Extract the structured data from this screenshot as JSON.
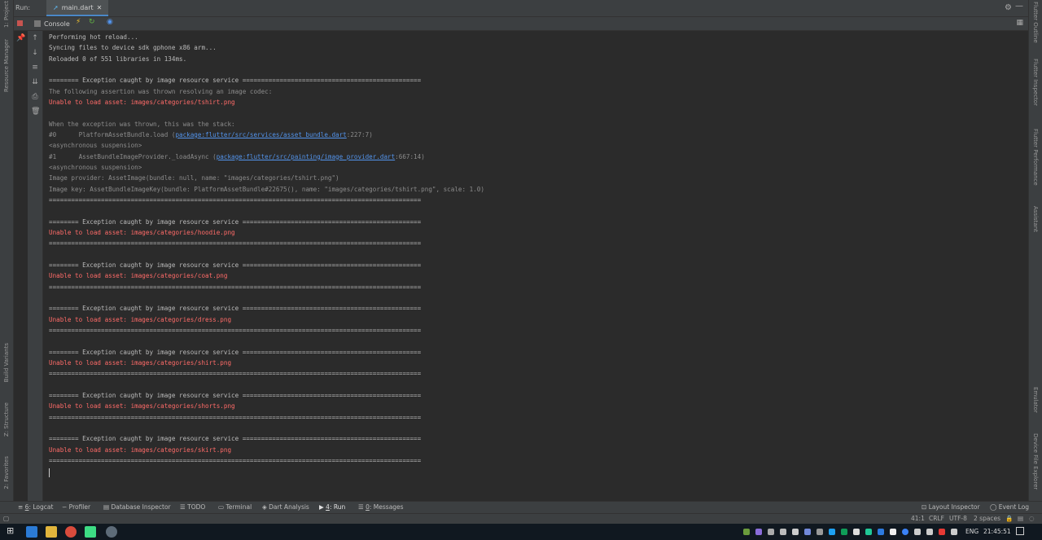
{
  "run_window": {
    "run_label": "Run:",
    "tab_name": "main.dart",
    "console_label": "Console"
  },
  "left_strip": {
    "project": "1: Project",
    "resource_manager": "Resource Manager",
    "build_variants": "Build Variants",
    "structure": "Z: Structure",
    "favorites": "2: Favorites"
  },
  "right_strip": {
    "flutter_outline": "Flutter Outline",
    "flutter_inspector": "Flutter Inspector",
    "flutter_performance": "Flutter Performance",
    "assistant": "Assistant",
    "emulator": "Emulator",
    "device_file_explorer": "Device File Explorer"
  },
  "console_lines": [
    {
      "text": "Performing hot reload...",
      "style": "normal"
    },
    {
      "text": "Syncing files to device sdk gphone x86 arm...",
      "style": "normal"
    },
    {
      "text": "Reloaded 0 of 551 libraries in 134ms.",
      "style": "normal"
    },
    {
      "text": "",
      "style": "normal"
    },
    {
      "text": "======== Exception caught by image resource service ================================================",
      "style": "normal"
    },
    {
      "text": "The following assertion was thrown resolving an image codec:",
      "style": "gray"
    },
    {
      "text": "Unable to load asset: images/categories/tshirt.png",
      "style": "err"
    },
    {
      "text": "",
      "style": "normal"
    },
    {
      "text": "When the exception was thrown, this was the stack:",
      "style": "gray"
    },
    {
      "text": "#0      PlatformAssetBundle.load (",
      "style": "gray",
      "link": "package:flutter/src/services/asset_bundle.dart",
      "after": ":227:7)"
    },
    {
      "text": "<asynchronous suspension>",
      "style": "gray"
    },
    {
      "text": "#1      AssetBundleImageProvider._loadAsync (",
      "style": "gray",
      "link": "package:flutter/src/painting/image_provider.dart",
      "after": ":667:14)"
    },
    {
      "text": "<asynchronous suspension>",
      "style": "gray"
    },
    {
      "text": "Image provider: AssetImage(bundle: null, name: \"images/categories/tshirt.png\")",
      "style": "gray"
    },
    {
      "text": "Image key: AssetBundleImageKey(bundle: PlatformAssetBundle#22675(), name: \"images/categories/tshirt.png\", scale: 1.0)",
      "style": "gray"
    },
    {
      "text": "====================================================================================================",
      "style": "normal"
    },
    {
      "text": "",
      "style": "normal"
    },
    {
      "text": "======== Exception caught by image resource service ================================================",
      "style": "normal"
    },
    {
      "text": "Unable to load asset: images/categories/hoodie.png",
      "style": "err"
    },
    {
      "text": "====================================================================================================",
      "style": "normal"
    },
    {
      "text": "",
      "style": "normal"
    },
    {
      "text": "======== Exception caught by image resource service ================================================",
      "style": "normal"
    },
    {
      "text": "Unable to load asset: images/categories/coat.png",
      "style": "err"
    },
    {
      "text": "====================================================================================================",
      "style": "normal"
    },
    {
      "text": "",
      "style": "normal"
    },
    {
      "text": "======== Exception caught by image resource service ================================================",
      "style": "normal"
    },
    {
      "text": "Unable to load asset: images/categories/dress.png",
      "style": "err"
    },
    {
      "text": "====================================================================================================",
      "style": "normal"
    },
    {
      "text": "",
      "style": "normal"
    },
    {
      "text": "======== Exception caught by image resource service ================================================",
      "style": "normal"
    },
    {
      "text": "Unable to load asset: images/categories/shirt.png",
      "style": "err"
    },
    {
      "text": "====================================================================================================",
      "style": "normal"
    },
    {
      "text": "",
      "style": "normal"
    },
    {
      "text": "======== Exception caught by image resource service ================================================",
      "style": "normal"
    },
    {
      "text": "Unable to load asset: images/categories/shorts.png",
      "style": "err"
    },
    {
      "text": "====================================================================================================",
      "style": "normal"
    },
    {
      "text": "",
      "style": "normal"
    },
    {
      "text": "======== Exception caught by image resource service ================================================",
      "style": "normal"
    },
    {
      "text": "Unable to load asset: images/categories/skirt.png",
      "style": "err"
    },
    {
      "text": "====================================================================================================",
      "style": "normal"
    }
  ],
  "bottom_tabs": [
    {
      "key": "6",
      "label": ": Logcat",
      "name": "logcat"
    },
    {
      "key": "",
      "label": "Profiler",
      "name": "profiler"
    },
    {
      "key": "",
      "label": "Database Inspector",
      "name": "database-inspector"
    },
    {
      "key": "",
      "label": "TODO",
      "name": "todo"
    },
    {
      "key": "",
      "label": "Terminal",
      "name": "terminal"
    },
    {
      "key": "",
      "label": "Dart Analysis",
      "name": "dart-analysis"
    },
    {
      "key": "4",
      "label": ": Run",
      "name": "run"
    },
    {
      "key": "0",
      "label": ": Messages",
      "name": "messages"
    }
  ],
  "bottom_right": {
    "layout_inspector": "Layout Inspector",
    "event_log": "Event Log"
  },
  "status": {
    "position": "41:1",
    "line_sep": "CRLF",
    "encoding": "UTF-8",
    "indent": "2 spaces"
  },
  "taskbar": {
    "language": "ENG",
    "time": "21:45:51"
  },
  "colors": {
    "error": "#ff6b68",
    "link": "#5394ec",
    "accent": "#4a88c7"
  }
}
